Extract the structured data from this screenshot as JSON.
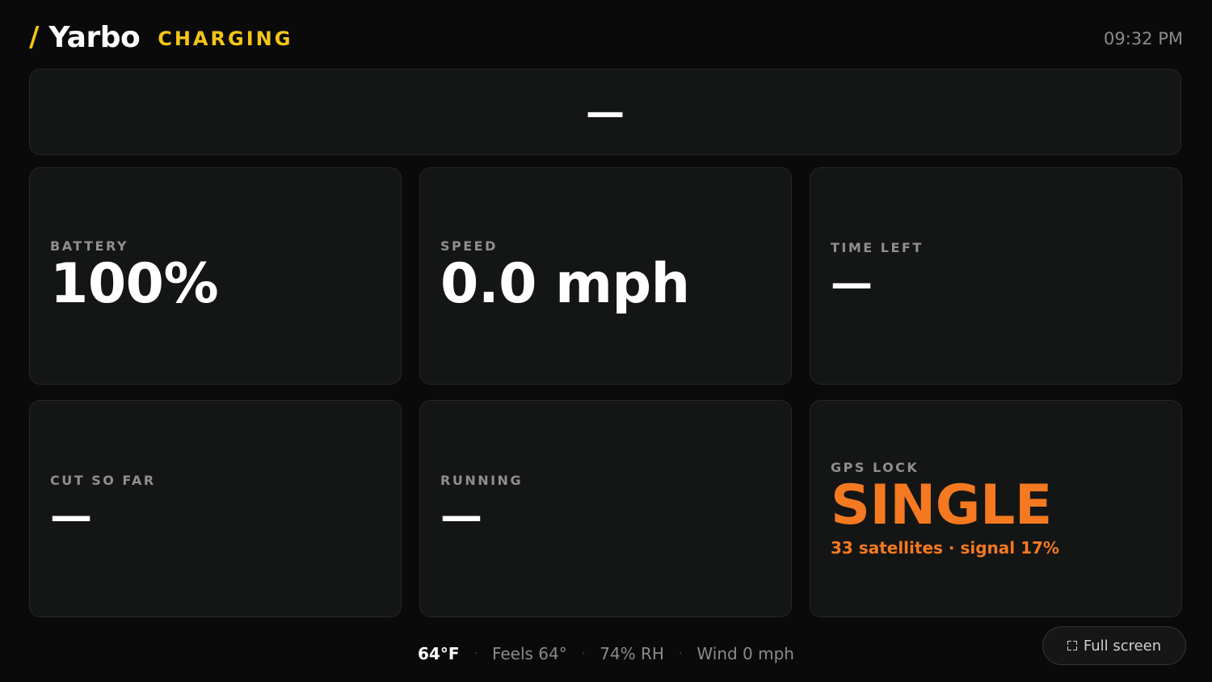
{
  "header": {
    "slash": "/",
    "brand": "Yarbo",
    "status": "CHARGING",
    "time": "09:32 PM"
  },
  "banner": {
    "value": "—"
  },
  "cards": [
    {
      "label": "BATTERY",
      "value": "100%"
    },
    {
      "label": "SPEED",
      "value": "0.0 mph"
    },
    {
      "label": "TIME LEFT",
      "value": "—"
    },
    {
      "label": "CUT SO FAR",
      "value": "—"
    },
    {
      "label": "RUNNING",
      "value": "—"
    },
    {
      "label": "GPS LOCK",
      "value": "SINGLE",
      "sub": "33 satellites · signal 17%"
    }
  ],
  "weather": {
    "temp": "64°F",
    "feels": "Feels 64°",
    "humidity": "74% RH",
    "wind": "Wind 0 mph",
    "separator": "·"
  },
  "fullscreen": {
    "label": "Full screen",
    "icon": "expand-icon"
  },
  "colors": {
    "accent_yellow": "#f5c518",
    "accent_orange": "#f47920",
    "background": "#0a0a0a",
    "card": "#141515"
  }
}
